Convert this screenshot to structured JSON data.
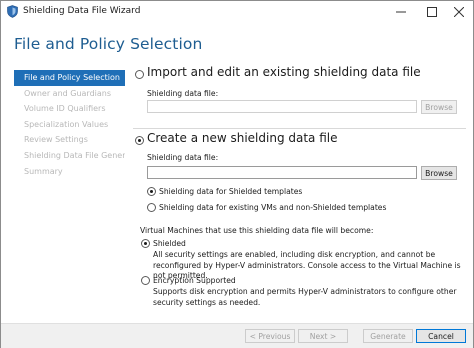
{
  "window": {
    "title": "Shielding Data File Wizard"
  },
  "header": {
    "title": "File and Policy Selection"
  },
  "nav": {
    "items": [
      {
        "label": "File and Policy Selection",
        "active": true
      },
      {
        "label": "Owner and Guardians",
        "active": false
      },
      {
        "label": "Volume ID Qualifiers",
        "active": false
      },
      {
        "label": "Specialization Values",
        "active": false
      },
      {
        "label": "Review Settings",
        "active": false
      },
      {
        "label": "Shielding Data File Gener...",
        "active": false
      },
      {
        "label": "Summary",
        "active": false
      }
    ]
  },
  "import_option": {
    "label": "Import and edit an existing shielding data file",
    "selected": false,
    "field_label": "Shielding data file:",
    "field_value": "",
    "browse_label": "Browse"
  },
  "create_option": {
    "label": "Create a new shielding data file",
    "selected": true,
    "field_label": "Shielding data file:",
    "field_value": "",
    "browse_label": "Browse",
    "template_options": [
      {
        "label": "Shielding data for Shielded templates",
        "selected": true
      },
      {
        "label": "Shielding data for existing VMs and non-Shielded templates",
        "selected": false
      }
    ]
  },
  "policy": {
    "heading": "Virtual Machines that use this shielding data file will become:",
    "options": [
      {
        "label": "Shielded",
        "selected": true,
        "description": "All security settings are enabled, including disk encryption, and cannot be reconfigured by Hyper-V administrators. Console access to the Virtual Machine is not permitted."
      },
      {
        "label": "Encryption Supported",
        "selected": false,
        "description": "Supports disk encryption and permits Hyper-V administrators to configure other security settings as needed."
      }
    ]
  },
  "footer": {
    "previous_label": "< Previous",
    "next_label": "Next >",
    "generate_label": "Generate",
    "cancel_label": "Cancel"
  },
  "colors": {
    "accent": "#1f6fb7",
    "header_title": "#1e5d91"
  }
}
